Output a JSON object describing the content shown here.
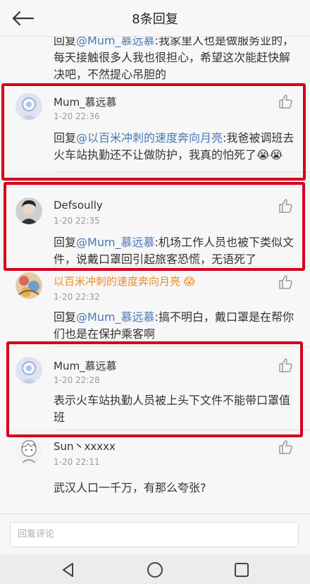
{
  "header": {
    "title": "8条回复"
  },
  "partial_comment": {
    "text_prefix": "回复",
    "mention": "@Mum_慕远慕",
    "text": ":我家里人也是做服务业的，每天接触很多人我也很担心，希望这次能赶快解决吧，不然提心吊胆的"
  },
  "comments": [
    {
      "user": "Mum_慕远慕",
      "time": "1-20 22:36",
      "prefix": "回复",
      "mention": "@以百米冲刺的速度奔向月亮",
      "text": ":我爸被调班去火车站执勤还不让做防护，我真的怕死了",
      "emoji": "😭😭"
    },
    {
      "user": "Defsoully",
      "time": "1-20 22:35",
      "prefix": "回复",
      "mention": "@Mum_慕远慕",
      "text": ":机场工作人员也被下类似文件，说戴口罩回引起旅客恐慌，无语死了"
    },
    {
      "user": "以百米冲刺的速度奔向月亮",
      "user_emoji": "😱",
      "time": "1-20 22:32",
      "prefix": "回复",
      "mention": "@Mum_慕远慕",
      "text": ":搞不明白，戴口罩是在帮你们也是在保护乘客啊"
    },
    {
      "user": "Mum_慕远慕",
      "time": "1-20 22:28",
      "text": "表示火车站执勤人员被上头下文件不能带口罩值班"
    },
    {
      "user": "Sun丶xxxxx",
      "time": "1-20 22:11",
      "text": "武汉人口一千万，有那么夸张?"
    }
  ],
  "footer": {
    "reply_placeholder": "回复评论"
  },
  "colors": {
    "highlight_box": "#d7001c",
    "mention": "#4a78b4",
    "orange_name": "#f08a24"
  }
}
